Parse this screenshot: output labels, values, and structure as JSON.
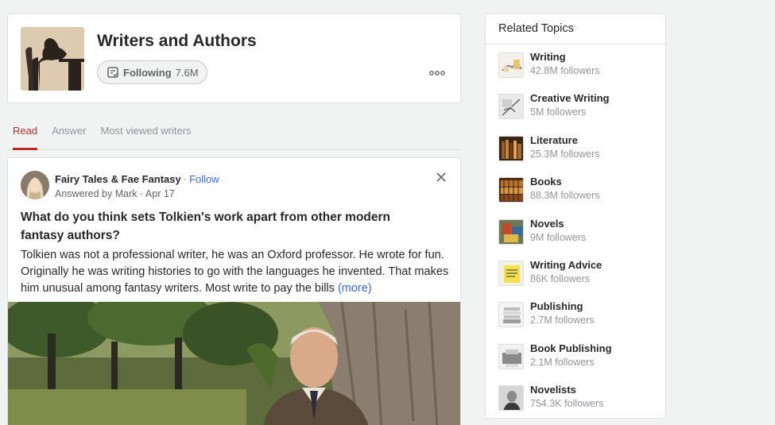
{
  "topic": {
    "title": "Writers and Authors",
    "follow_label": "Following",
    "follow_count": "7.6M"
  },
  "tabs": [
    {
      "label": "Read",
      "active": true
    },
    {
      "label": "Answer",
      "active": false
    },
    {
      "label": "Most viewed writers",
      "active": false
    }
  ],
  "post": {
    "space": "Fairy Tales & Fae Fantasy",
    "separator": "·",
    "follow": "Follow",
    "answered_by": "Answered by Mark · Apr 17",
    "question": "What do you think sets Tolkien's work apart from other modern fantasy authors?",
    "excerpt": "Tolkien was not a professional writer, he was an Oxford professor. He wrote for fun. Originally he was writing histories to go with the languages he invented. That makes him unusual among fantasy writers. Most write to pay the bills",
    "more": "(more)"
  },
  "related": {
    "heading": "Related Topics",
    "items": [
      {
        "name": "Writing",
        "followers": "42.8M followers"
      },
      {
        "name": "Creative Writing",
        "followers": "5M followers"
      },
      {
        "name": "Literature",
        "followers": "25.3M followers"
      },
      {
        "name": "Books",
        "followers": "88.3M followers"
      },
      {
        "name": "Novels",
        "followers": "9M followers"
      },
      {
        "name": "Writing Advice",
        "followers": "86K followers"
      },
      {
        "name": "Publishing",
        "followers": "2.7M followers"
      },
      {
        "name": "Book Publishing",
        "followers": "2.1M followers"
      },
      {
        "name": "Novelists",
        "followers": "754.3K followers"
      }
    ]
  },
  "colors": {
    "accent_red": "#b92b27",
    "link_blue": "#2e69ff"
  }
}
